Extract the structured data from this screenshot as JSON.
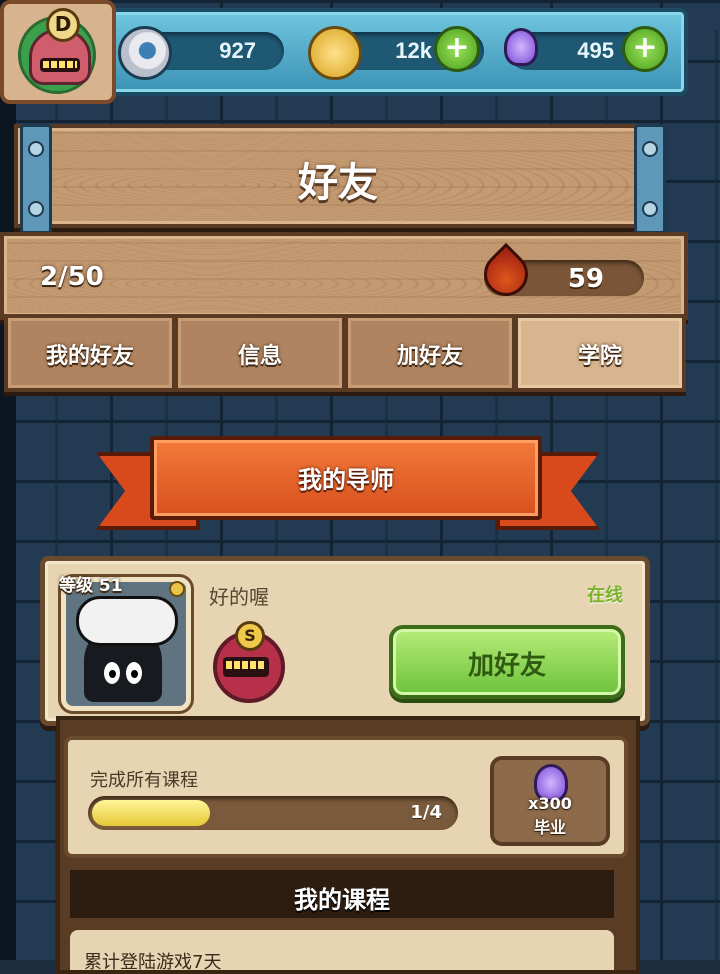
{
  "resources": {
    "eyeballs": "927",
    "coins": "12k",
    "potions": "495"
  },
  "player": {
    "rank": "D"
  },
  "page": {
    "title": "好友"
  },
  "friends": {
    "count": "2/50",
    "energy": "59"
  },
  "tabs": [
    {
      "label": "我的好友",
      "active": false
    },
    {
      "label": "信息",
      "active": false
    },
    {
      "label": "加好友",
      "active": false
    },
    {
      "label": "学院",
      "active": true
    }
  ],
  "mentor_section": {
    "title": "我的导师"
  },
  "mentor": {
    "level": "等级 51",
    "name": "好的喔",
    "status": "在线",
    "rank": "S",
    "add_button": "加好友"
  },
  "course": {
    "goal": "完成所有课程",
    "progress_text": "1/4",
    "progress_fraction": 0.25,
    "reward_qty": "x300",
    "reward_label": "毕业"
  },
  "courses_section": {
    "title": "我的课程",
    "first_item": "累计登陆游戏7天"
  },
  "colors": {
    "accent_green": "#6cc23a",
    "ribbon_orange": "#d8501e",
    "wood": "#c49a72"
  },
  "icons": {
    "eyeball": "eyeball-icon",
    "coin": "coin-icon",
    "potion": "potion-icon",
    "blood": "blood-drop-icon"
  }
}
